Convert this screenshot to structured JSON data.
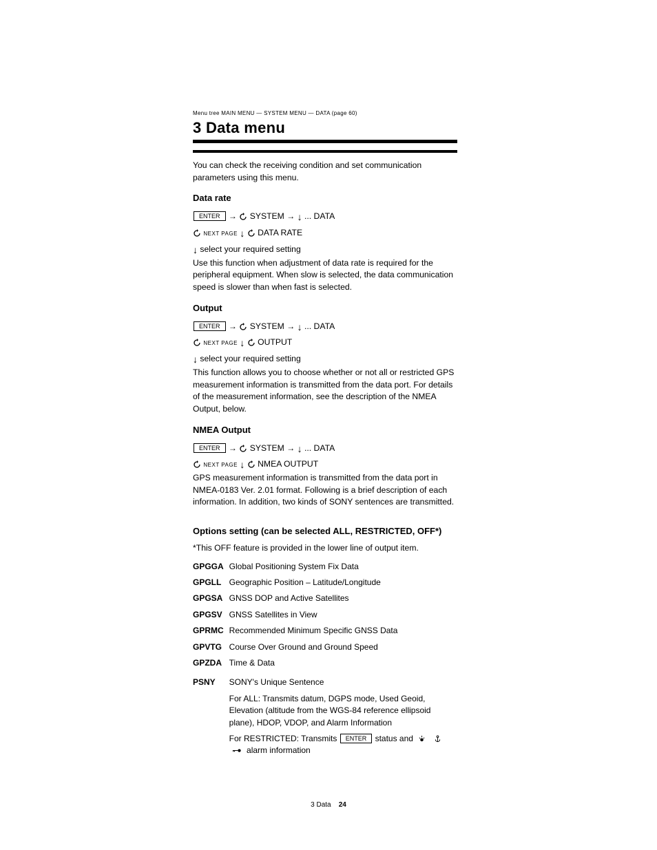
{
  "heading": "3 Data menu",
  "intro": "You can check the receiving condition and set communication parameters using this menu.",
  "sections": [
    {
      "title": "Data rate",
      "nav_line1_pre": "",
      "nav_word1": "SYSTEM",
      "nav_seg1": "DATA",
      "nav_extra": "...",
      "nav_line2_end": "DATA RATE",
      "nav_line3": "select your required setting",
      "desc": "Use this function when adjustment of data rate is required for the peripheral equipment. When slow is selected, the data communication speed is slower than when fast is selected."
    },
    {
      "title": "Output",
      "nav_line1_pre": "",
      "nav_word1": "SYSTEM",
      "nav_seg1": "DATA",
      "nav_extra": "...",
      "nav_line2_end": "OUTPUT",
      "nav_line3": "select your required setting",
      "desc": "This function allows you to choose whether or not all or restricted GPS measurement information is transmitted from the data port. For details of the measurement information, see the description of the NMEA Output, below."
    },
    {
      "title": "NMEA Output",
      "nav_line1_pre": "",
      "nav_word1": "SYSTEM",
      "nav_seg1": "DATA",
      "nav_extra": "...",
      "nav_line2_end": "NMEA OUTPUT",
      "desc": "GPS measurement information is transmitted from the data port in NMEA-0183 Ver. 2.01 format. Following is a brief description of each information. In addition, two kinds of SONY sentences are transmitted."
    }
  ],
  "options_note": "Options setting (can be selected ALL, RESTRICTED, OFF*)",
  "options_footnote": "*This OFF feature is provided in the lower line of output item.",
  "table": {
    "rows": [
      {
        "k": "GPGGA",
        "v": "Global Positioning System Fix Data"
      },
      {
        "k": "GPGLL",
        "v": "Geographic Position – Latitude/Longitude"
      },
      {
        "k": "GPGSA",
        "v": "GNSS DOP and Active Satellites"
      },
      {
        "k": "GPGSV",
        "v": "GNSS Satellites in View"
      },
      {
        "k": "GPRMC",
        "v": "Recommended Minimum Specific GNSS Data"
      },
      {
        "k": "GPVTG",
        "v": "Course Over Ground and Ground Speed"
      },
      {
        "k": "GPZDA",
        "v": "Time & Data"
      },
      {
        "k": "PSNY",
        "v": "SONY's Unique Sentence"
      }
    ]
  },
  "psny_line1": "For ALL: Transmits datum, DGPS mode, Used Geoid, Elevation (altitude from the WGS-84 reference ellipsoid plane), HDOP, VDOP, and Alarm Information",
  "psny_line2_a": "For RESTRICTED:",
  "psny_line2_b": "Transmits",
  "psny_line2_c": "status and",
  "psny_line2_d": "alarm information",
  "enter_label": "ENTER",
  "next_page": "NEXT PAGE",
  "page_number_prefix": "3 Data",
  "page_number": "24",
  "menu_path": "Menu tree  MAIN MENU — SYSTEM MENU — DATA (page 60)"
}
